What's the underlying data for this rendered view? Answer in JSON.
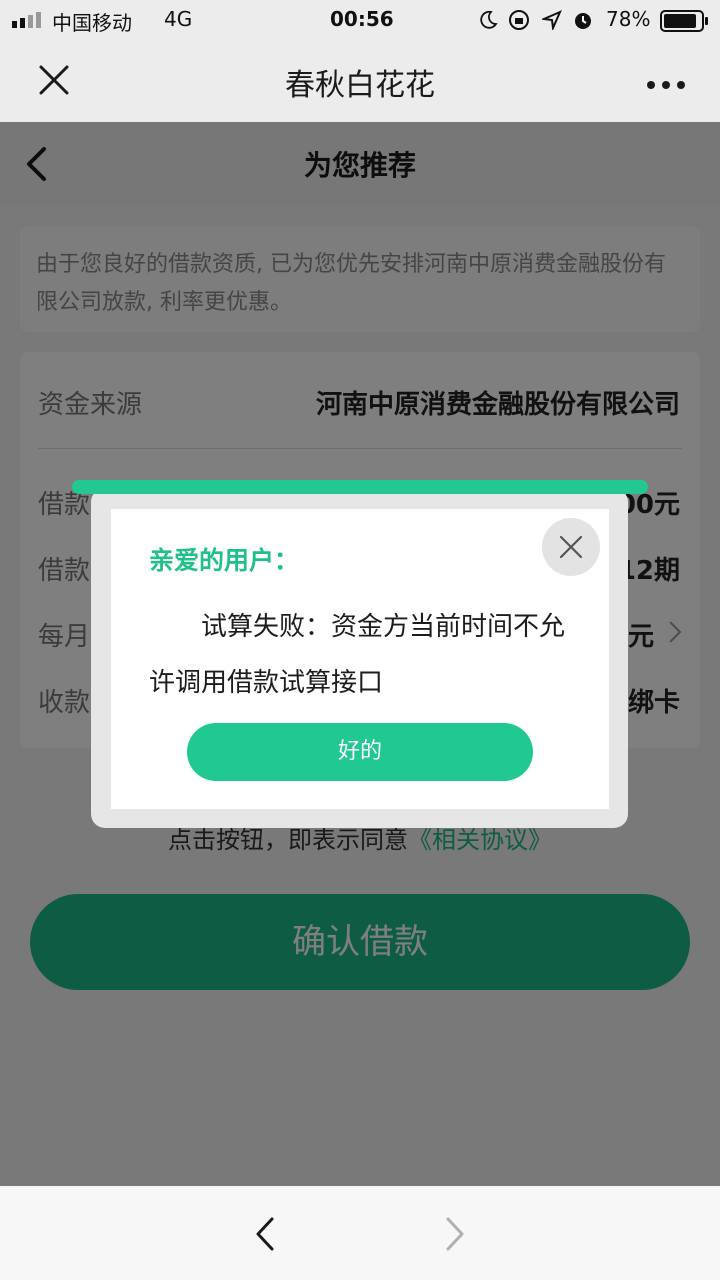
{
  "status_bar": {
    "carrier": "中国移动",
    "network": "4G",
    "time": "00:56",
    "battery": "78%"
  },
  "title_bar": {
    "title": "春秋白花花",
    "close_icon": "close-icon",
    "more_icon": "more-dots-icon"
  },
  "page": {
    "title": "为您推荐",
    "back_icon": "chevron-left-icon",
    "notice": "由于您良好的借款资质, 已为您优先安排河南中原消费金融股份有限公司放款, 利率更优惠。",
    "rows": [
      {
        "label": "资金来源",
        "value": "河南中原消费金融股份有限公司"
      },
      {
        "label": "借款",
        "value": "00元"
      },
      {
        "label": "借款",
        "value": "12期"
      },
      {
        "label": "每月",
        "value": "元"
      },
      {
        "label": "收款",
        "value": "绑卡"
      }
    ],
    "agreement_prefix": "点击按钮，即表示同意",
    "agreement_link": "《相关协议》",
    "confirm_label": "确认借款"
  },
  "dialog": {
    "heading": "亲爱的用户：",
    "message": "试算失败：资金方当前时间不允许调用借款试算接口",
    "ok_label": "好的",
    "close_icon": "close-icon"
  },
  "toolbar": {
    "back_icon": "chevron-left-icon",
    "forward_icon": "chevron-right-icon"
  },
  "colors": {
    "accent": "#22c891",
    "confirm": "#1fb88a",
    "overlay": "rgba(0,0,0,0.5)"
  }
}
